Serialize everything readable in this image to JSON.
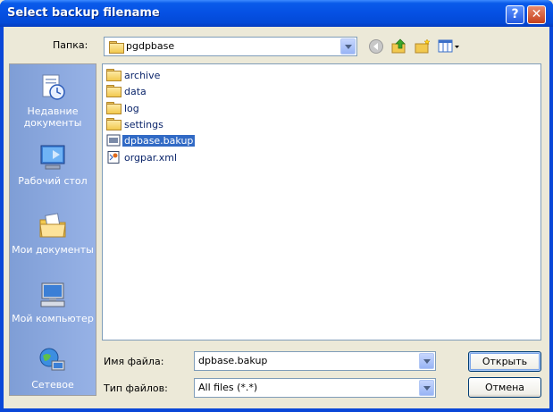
{
  "window": {
    "title": "Select backup filename",
    "help_glyph": "?",
    "close_glyph": "✕"
  },
  "folder_row": {
    "label": "Папка:",
    "current_folder": "pgdpbase"
  },
  "places": [
    {
      "label": "Недавние документы",
      "icon": "recent-documents-icon"
    },
    {
      "label": "Рабочий стол",
      "icon": "desktop-icon"
    },
    {
      "label": "Мои документы",
      "icon": "my-documents-icon"
    },
    {
      "label": "Мой компьютер",
      "icon": "my-computer-icon"
    },
    {
      "label": "Сетевое",
      "icon": "network-icon"
    }
  ],
  "files": [
    {
      "name": "archive",
      "type": "folder"
    },
    {
      "name": "data",
      "type": "folder"
    },
    {
      "name": "log",
      "type": "folder"
    },
    {
      "name": "settings",
      "type": "folder"
    },
    {
      "name": "dpbase.bakup",
      "type": "file",
      "selected": true
    },
    {
      "name": "orgpar.xml",
      "type": "xml"
    }
  ],
  "filename": {
    "label": "Имя файла:",
    "value": "dpbase.bakup"
  },
  "filetype": {
    "label": "Тип файлов:",
    "value": "All files (*.*)"
  },
  "buttons": {
    "open": "Открыть",
    "cancel": "Отмена"
  },
  "colors": {
    "title_bar": "#0550e3",
    "selection": "#316ac5",
    "dialog_bg": "#ece9d8"
  }
}
